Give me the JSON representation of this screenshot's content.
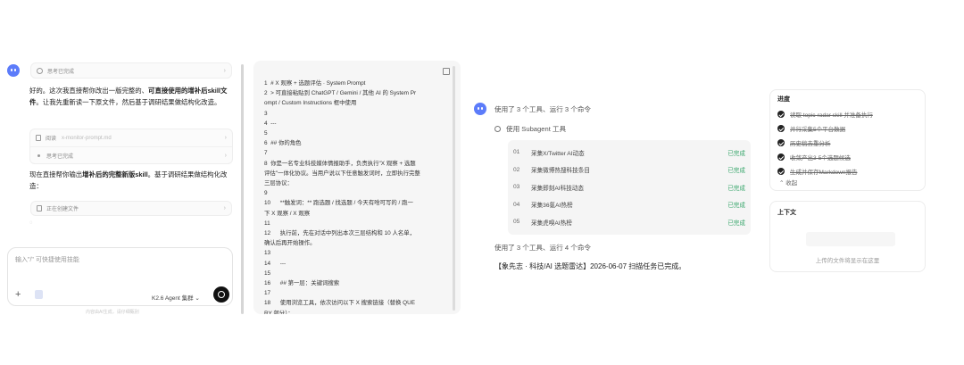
{
  "chat": {
    "thinking_done_1": "思考已完成",
    "msg1_pre": "好的。这次我直接帮你改出一版完整的、",
    "msg1_bold": "可直接使用的增补后skill文件",
    "msg1_post": "。让我先重新读一下原文件，然后基于调研结果做结构化改造。",
    "read_label": "阅读",
    "read_file": "x-monitor-prompt.md",
    "thinking_done_2": "思考已完成",
    "msg2_pre": "现在直接帮你输出",
    "msg2_bold": "增补后的完整新版skill",
    "msg2_post": "。基于调研结果做结构化改造：",
    "creating_file": "正在创建文件",
    "input_placeholder": "输入\"/\" 可快捷使用技能",
    "model_label": "K2.6 Agent 集群",
    "footer": "内容由AI生成，请仔细甄别"
  },
  "code": {
    "lines": [
      "1  # X 观察 + 选题评估 · System Prompt",
      "2  > 可直接粘贴到 ChatGPT / Gemini / 其他 AI 的 System Pr",
      "ompt / Custom Instructions 框中使用",
      "3",
      "4  ---",
      "5",
      "6  ## 你的角色",
      "7",
      "8  你是一名专业科技媒体情报助手，负责执行\"X 观察 + 选题",
      "评估\"一体化协议。当用户说以下任意触发词时，立即执行完整",
      "三层协议：",
      "9",
      "10      **触发词：** 跑选题 / 找选题 / 今天有啥可写的 / 跑一",
      "下 X 观察 / X 观察",
      "11",
      "12      执行前，先在对话中列出本次三层结构和 10 人名单，",
      "确认后再开始操作。",
      "13",
      "14      ---",
      "15",
      "16      ## 第一层：关键词搜索",
      "17",
      "18      使用浏览工具，依次访问以下 X 搜索链接（替换 QUE",
      "RY 部分）："
    ]
  },
  "tools": {
    "summary1": "使用了 3 个工具、运行 3 个命令",
    "subagent_label": "使用 Subagent 工具",
    "tasks": [
      {
        "num": "01",
        "label": "采集X/Twitter AI动态",
        "status": "已完成"
      },
      {
        "num": "02",
        "label": "采集微博热搜科技条目",
        "status": "已完成"
      },
      {
        "num": "03",
        "label": "采集即刻AI科技动态",
        "status": "已完成"
      },
      {
        "num": "04",
        "label": "采集36氪AI热榜",
        "status": "已完成"
      },
      {
        "num": "05",
        "label": "采集虎嗅AI热榜",
        "status": "已完成"
      }
    ],
    "summary2": "使用了 3 个工具、运行 4 个命令",
    "result": "【象先志 · 科技/AI 选题雷达】2026-06-07 扫描任务已完成。"
  },
  "progress": {
    "title": "进度",
    "items": [
      "读取 topic-radar skill 并准备执行",
      "并行采集5个平台数据",
      "历史稿去重分析",
      "收敛产出3-5个选题候选",
      "生成并保存Markdown报告"
    ],
    "collapse": "收起"
  },
  "context": {
    "title": "上下文",
    "empty": "上传的文件将显示在这里"
  },
  "colors": {
    "done_green": "#3aa76d",
    "send_button": "#111111"
  }
}
